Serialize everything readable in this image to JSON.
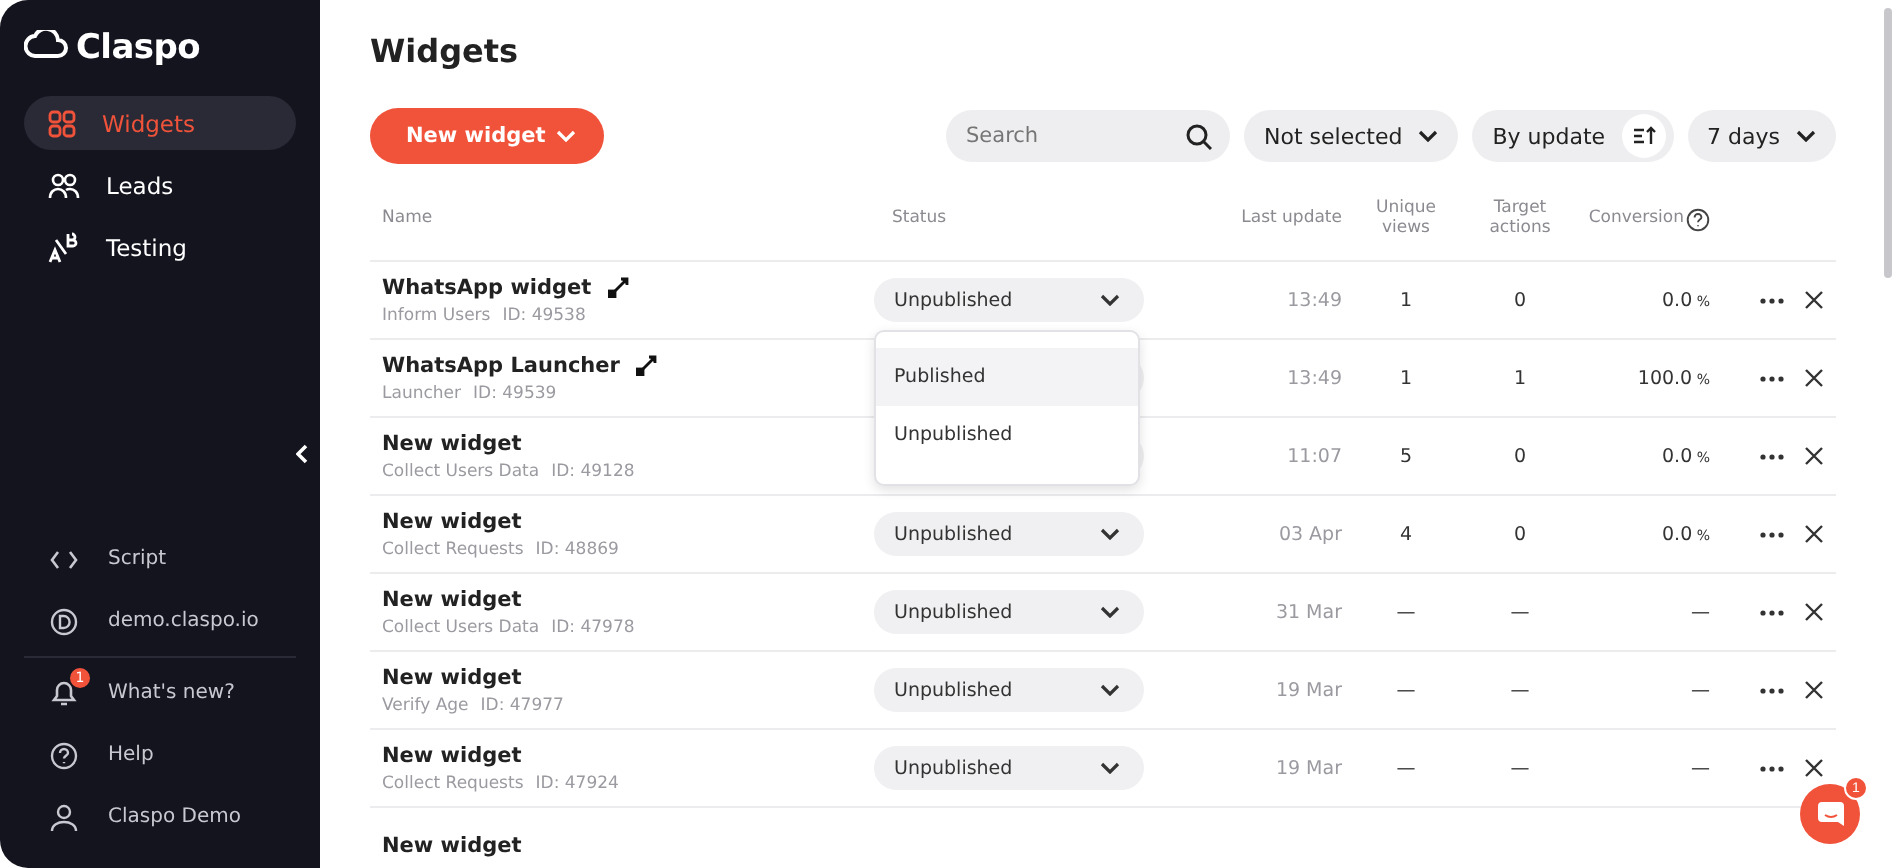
{
  "sidebar": {
    "logo": "Claspo",
    "nav": [
      {
        "label": "Widgets",
        "selected": true
      },
      {
        "label": "Leads",
        "selected": false
      },
      {
        "label": "Testing",
        "selected": false
      }
    ],
    "bottom": [
      {
        "label": "Script"
      },
      {
        "label": "demo.claspo.io"
      }
    ],
    "footer": [
      {
        "label": "What's new?",
        "badge": "1"
      },
      {
        "label": "Help"
      },
      {
        "label": "Claspo Demo"
      }
    ]
  },
  "page": {
    "title": "Widgets",
    "new_button": "New widget",
    "search": {
      "placeholder": "Search"
    },
    "filter": "Not selected",
    "sort": "By update",
    "period": "7 days"
  },
  "table": {
    "columns": [
      "Name",
      "Status",
      "Last update",
      "Unique views",
      "Target actions",
      "Conversion"
    ],
    "rows": [
      {
        "name": "WhatsApp widget",
        "linked": true,
        "type": "Inform Users",
        "id": "ID: 49538",
        "status": "Unpublished",
        "last_update": "13:49",
        "views": "1",
        "actions": "0",
        "conversion": "0.0",
        "unit": "%",
        "dropdown": {
          "options": [
            {
              "label": "Published",
              "selected": true
            },
            {
              "label": "Unpublished",
              "selected": false
            }
          ]
        }
      },
      {
        "name": "WhatsApp Launcher",
        "linked": true,
        "type": "Launcher",
        "id": "ID: 49539",
        "last_update": "13:49",
        "views": "1",
        "actions": "1",
        "conversion": "100.0",
        "unit": "%"
      },
      {
        "name": "New widget",
        "linked": false,
        "type": "Collect Users Data",
        "id": "ID: 49128",
        "last_update": "11:07",
        "views": "5",
        "actions": "0",
        "conversion": "0.0",
        "unit": "%"
      },
      {
        "name": "New widget",
        "linked": false,
        "type": "Collect Requests",
        "id": "ID: 48869",
        "status": "Unpublished",
        "last_update": "03 Apr",
        "views": "4",
        "actions": "0",
        "conversion": "0.0",
        "unit": "%"
      },
      {
        "name": "New widget",
        "linked": false,
        "type": "Collect Users Data",
        "id": "ID: 47978",
        "status": "Unpublished",
        "last_update": "31 Mar",
        "views": "—",
        "actions": "—",
        "conversion": "—"
      },
      {
        "name": "New widget",
        "linked": false,
        "type": "Verify Age",
        "id": "ID: 47977",
        "status": "Unpublished",
        "last_update": "19 Mar",
        "views": "—",
        "actions": "—",
        "conversion": "—"
      },
      {
        "name": "New widget",
        "linked": false,
        "type": "Collect Requests",
        "id": "ID: 47924",
        "status": "Unpublished",
        "last_update": "19 Mar",
        "views": "—",
        "actions": "—",
        "conversion": "—"
      },
      {
        "name": "New widget",
        "linked": false
      }
    ]
  },
  "chat": {
    "badge": "1"
  }
}
